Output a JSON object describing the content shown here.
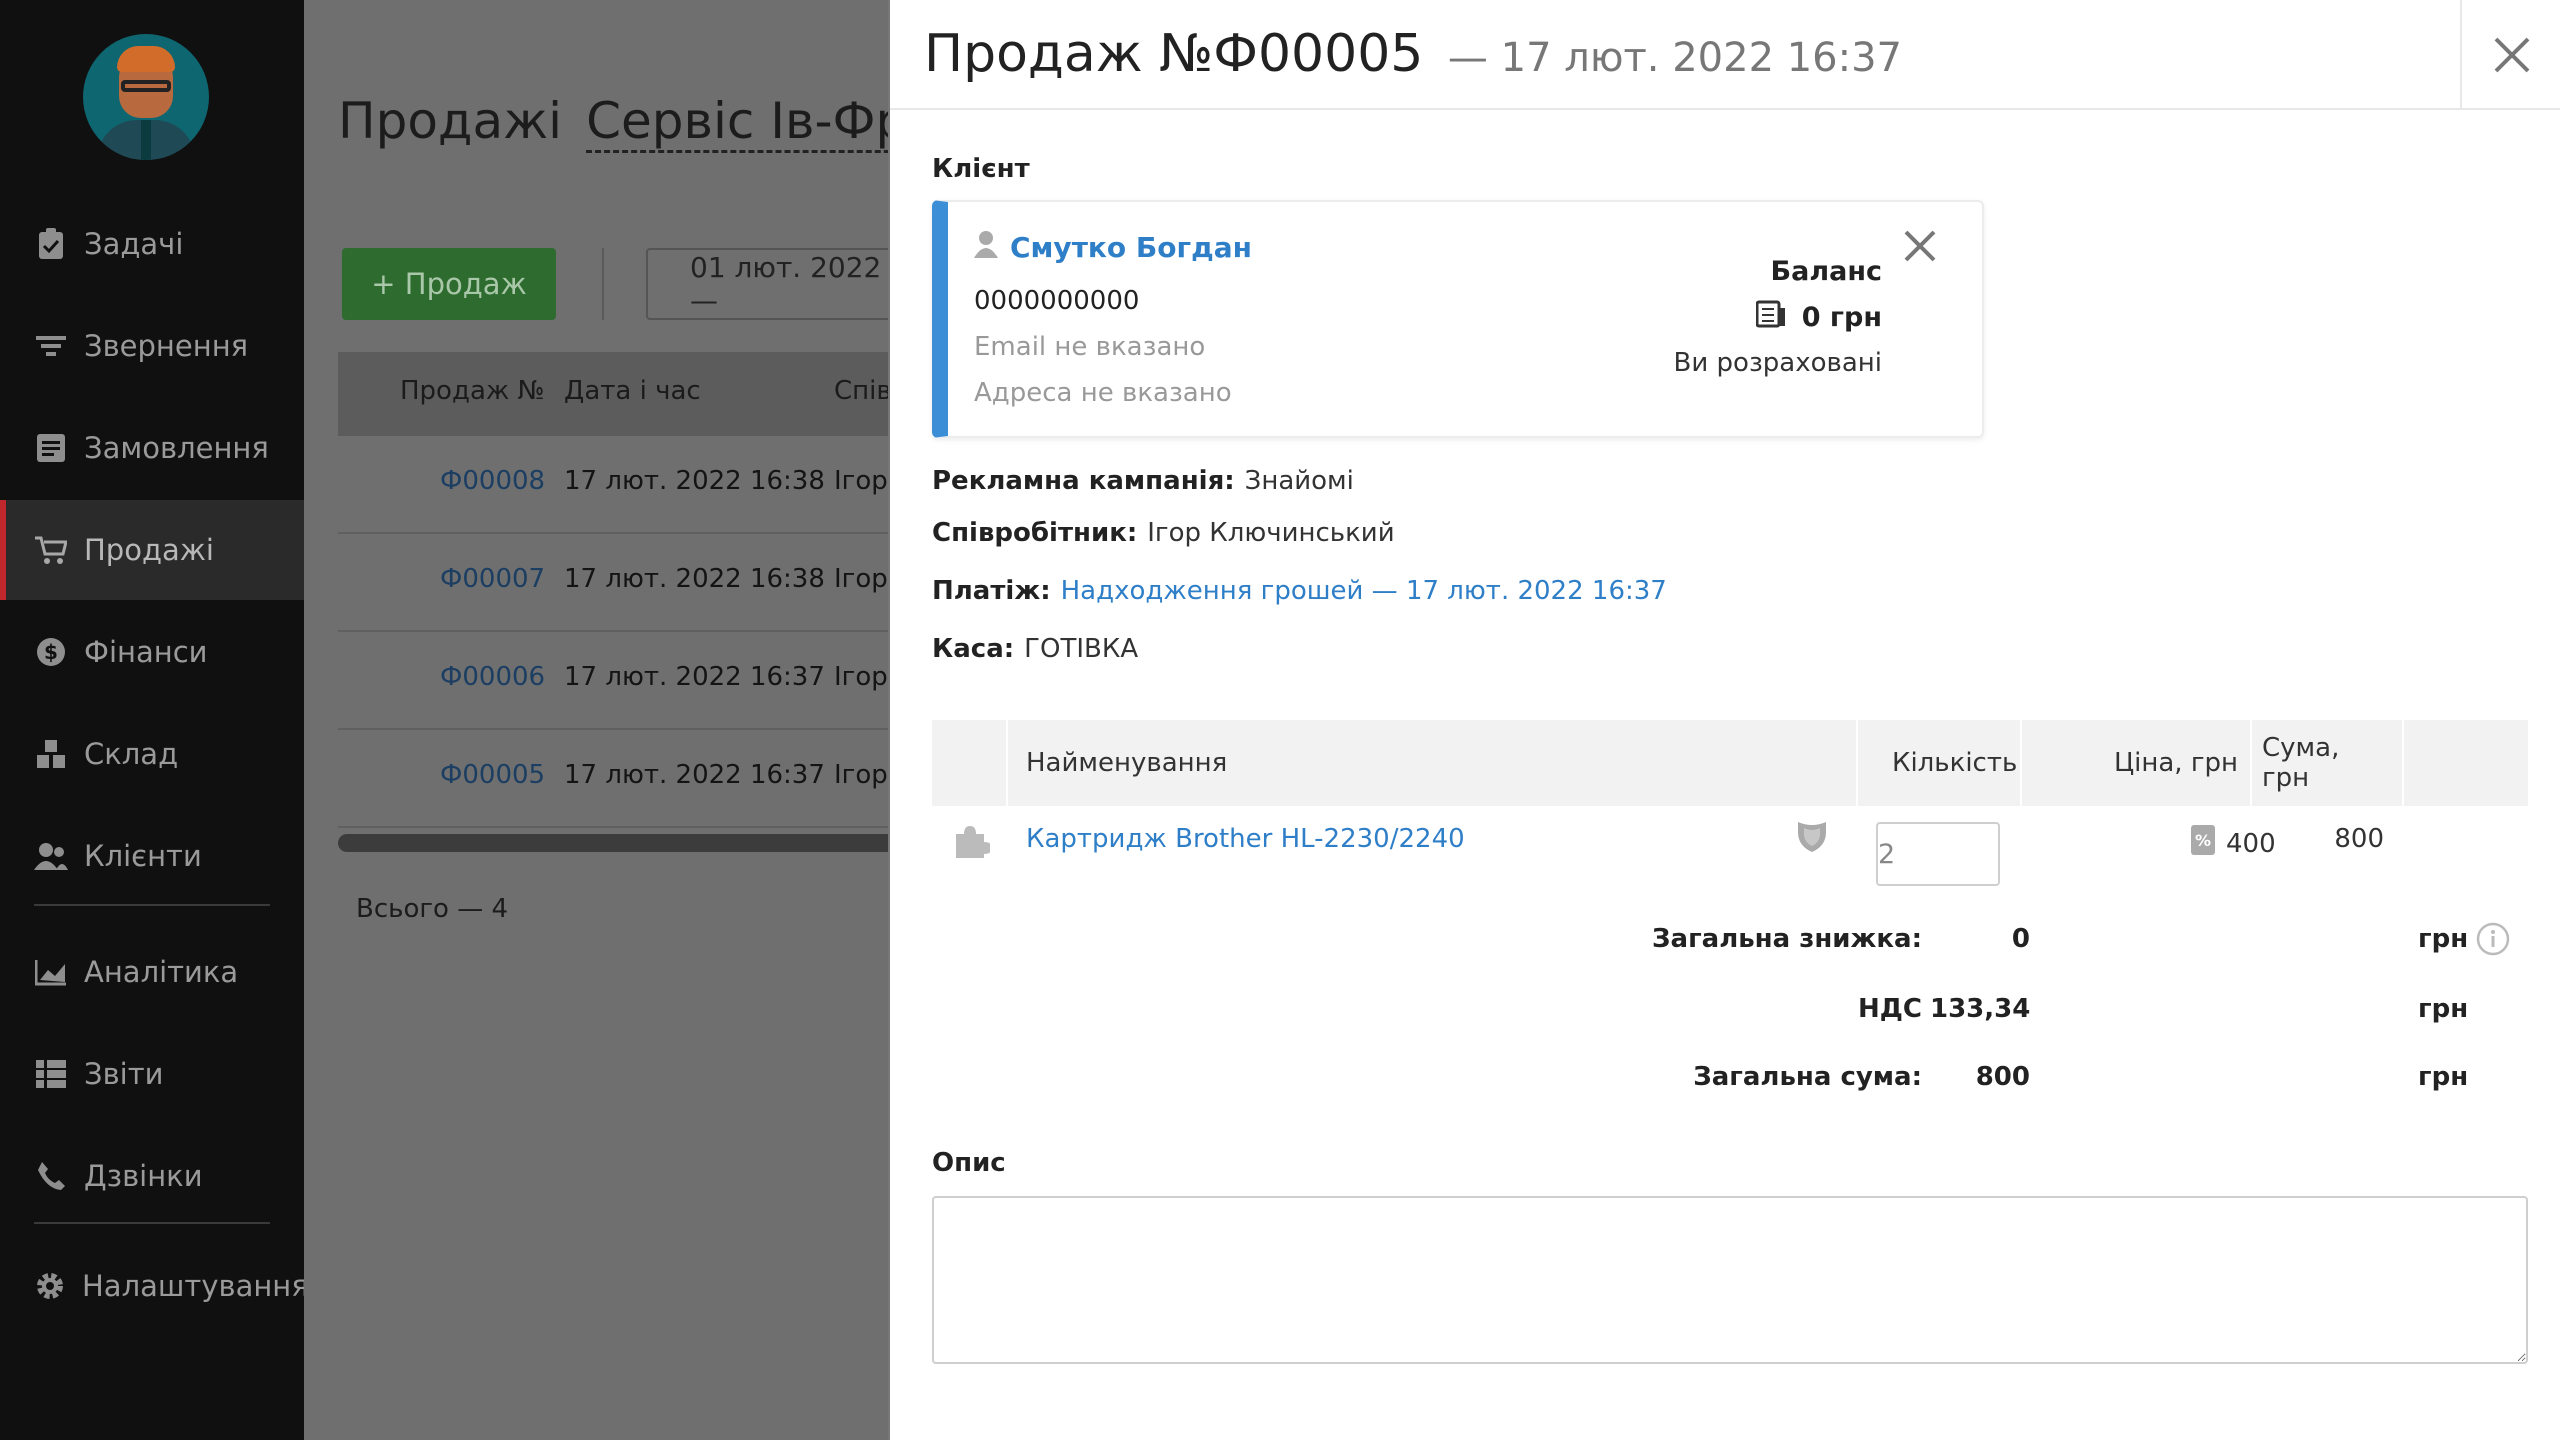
{
  "sidebar": {
    "items": [
      {
        "label": "Задачі",
        "icon": "clipboard-icon"
      },
      {
        "label": "Звернення",
        "icon": "filter-icon"
      },
      {
        "label": "Замовлення",
        "icon": "order-icon"
      },
      {
        "label": "Продажі",
        "icon": "cart-icon"
      },
      {
        "label": "Фінанси",
        "icon": "dollar-icon"
      },
      {
        "label": "Склад",
        "icon": "boxes-icon"
      },
      {
        "label": "Клієнти",
        "icon": "users-icon"
      },
      {
        "label": "Аналітика",
        "icon": "chart-icon"
      },
      {
        "label": "Звіти",
        "icon": "list-icon"
      },
      {
        "label": "Дзвінки",
        "icon": "phone-icon"
      },
      {
        "label": "Налаштування",
        "icon": "gear-icon"
      }
    ],
    "active": "Продажі"
  },
  "background": {
    "title": "Продажі",
    "store": "Сервіс Ів-Фран",
    "sale_button": "+ Продаж",
    "date_filter": "01 лют. 2022 —",
    "columns": [
      "Продаж №",
      "Дата і час",
      "Спів"
    ],
    "rows": [
      {
        "id": "Ф00008",
        "date": "17 лют. 2022 16:38",
        "employee": "Ігор"
      },
      {
        "id": "Ф00007",
        "date": "17 лют. 2022 16:38",
        "employee": "Ігор"
      },
      {
        "id": "Ф00006",
        "date": "17 лют. 2022 16:37",
        "employee": "Ігор"
      },
      {
        "id": "Ф00005",
        "date": "17 лют. 2022 16:37",
        "employee": "Ігор"
      }
    ],
    "total": "Всього — 4"
  },
  "panel": {
    "title": "Продаж №Ф00005",
    "subtitle": "— 17 лют. 2022 16:37",
    "client_label": "Клієнт",
    "client": {
      "name": "Смутко Богдан",
      "phone": "0000000000",
      "email": "Email не вказано",
      "address": "Адреса не вказано",
      "balance_title": "Баланс",
      "balance_value": "0 грн",
      "balance_status": "Ви розраховані"
    },
    "campaign_label": "Рекламна кампанія:",
    "campaign_value": "Знайомі",
    "employee_label": "Співробітник:",
    "employee_value": "Ігор Ключинський",
    "payment_label": "Платіж:",
    "payment_value": "Надходження грошей — 17 лют. 2022 16:37",
    "cashbox_label": "Каса:",
    "cashbox_value": "ГОТІВКА",
    "table": {
      "columns": [
        "Найменування",
        "Кількість",
        "Ціна, грн",
        "Сума, грн"
      ],
      "items": [
        {
          "name": "Картридж Brother HL-2230/2240",
          "qty": "2",
          "price": "400",
          "sum": "800"
        }
      ]
    },
    "totals": {
      "discount_label": "Загальна знижка:",
      "discount_value": "0",
      "vat_label": "НДС",
      "vat_value": "133,34",
      "total_label": "Загальна сума:",
      "total_value": "800",
      "currency": "грн"
    },
    "description_label": "Опис",
    "description_value": ""
  },
  "colors": {
    "link": "#2f7fc8",
    "accent_border": "#3c8fd6",
    "active_nav": "#c0272d",
    "sale_button": "#2e6b2e"
  }
}
